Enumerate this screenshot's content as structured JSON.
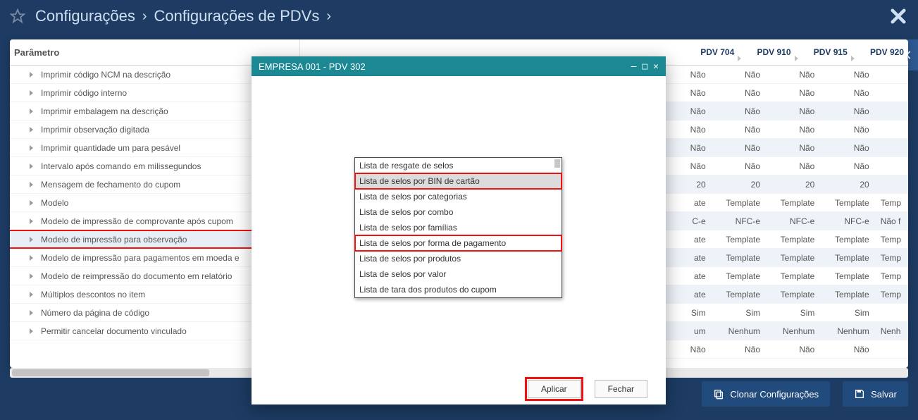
{
  "breadcrumb": {
    "a": "Configurações",
    "b": "Configurações de PDVs"
  },
  "param_header": "Parâmetro",
  "params": [
    {
      "label": "Imprimir código NCM na descrição"
    },
    {
      "label": "Imprimir código interno"
    },
    {
      "label": "Imprimir embalagem na descrição"
    },
    {
      "label": "Imprimir observação digitada"
    },
    {
      "label": "Imprimir quantidade um para pesável"
    },
    {
      "label": "Intervalo após comando em milissegundos"
    },
    {
      "label": "Mensagem de fechamento do cupom"
    },
    {
      "label": "Modelo"
    },
    {
      "label": "Modelo de impressão de comprovante após cupom"
    },
    {
      "label": "Modelo de impressão para observação",
      "highlight": true
    },
    {
      "label": "Modelo de impressão para pagamentos em moeda e"
    },
    {
      "label": "Modelo de reimpressão do documento em relatório"
    },
    {
      "label": "Múltiplos descontos no item"
    },
    {
      "label": "Número da página de código"
    },
    {
      "label": "Permitir cancelar documento vinculado"
    }
  ],
  "pdv_headers": [
    "PDV 704",
    "PDV 910",
    "PDV 915",
    "PDV 920"
  ],
  "data_rows": [
    {
      "vals": [
        "Não",
        "Não",
        "Não",
        "Não"
      ],
      "alt": false,
      "cut": true
    },
    {
      "vals": [
        "Não",
        "Não",
        "Não",
        "Não"
      ],
      "alt": false
    },
    {
      "vals": [
        "Não",
        "Não",
        "Não",
        "Não"
      ],
      "alt": true
    },
    {
      "vals": [
        "Não",
        "Não",
        "Não",
        "Não"
      ],
      "alt": false
    },
    {
      "vals": [
        "Não",
        "Não",
        "Não",
        "Não"
      ],
      "alt": true
    },
    {
      "vals": [
        "Não",
        "Não",
        "Não",
        "Não"
      ],
      "alt": false
    },
    {
      "vals": [
        "20",
        "20",
        "20",
        "20"
      ],
      "alt": true
    },
    {
      "vals": [
        "ate",
        "Template",
        "Template",
        "Template",
        "Temp"
      ],
      "alt": false
    },
    {
      "vals": [
        "C-e",
        "NFC-e",
        "NFC-e",
        "NFC-e",
        "Não f"
      ],
      "alt": true
    },
    {
      "vals": [
        "ate",
        "Template",
        "Template",
        "Template",
        "Temp"
      ],
      "alt": false
    },
    {
      "vals": [
        "ate",
        "Template",
        "Template",
        "Template",
        "Temp"
      ],
      "alt": true,
      "hl": true
    },
    {
      "vals": [
        "ate",
        "Template",
        "Template",
        "Template",
        "Temp"
      ],
      "alt": false
    },
    {
      "vals": [
        "ate",
        "Template",
        "Template",
        "Template",
        "Temp"
      ],
      "alt": true
    },
    {
      "vals": [
        "Sim",
        "Sim",
        "Sim",
        "Sim"
      ],
      "alt": false
    },
    {
      "vals": [
        "um",
        "Nenhum",
        "Nenhum",
        "Nenhum",
        "Nenh"
      ],
      "alt": true
    },
    {
      "vals": [
        "Não",
        "Não",
        "Não",
        "Não"
      ],
      "alt": false
    }
  ],
  "buttons": {
    "clone": "Clonar Configurações",
    "save": "Salvar"
  },
  "modal": {
    "title": "EMPRESA 001 - PDV 302",
    "options": [
      {
        "label": "Lista de resgate de selos"
      },
      {
        "label": "Lista de selos por BIN de cartão",
        "selected": true,
        "red": true
      },
      {
        "label": "Lista de selos por categorias"
      },
      {
        "label": "Lista de selos por combo"
      },
      {
        "label": "Lista de selos por famílias"
      },
      {
        "label": "Lista de selos por forma de pagamento",
        "red": true
      },
      {
        "label": "Lista de selos por produtos"
      },
      {
        "label": "Lista de selos por valor"
      },
      {
        "label": "Lista de tara dos produtos do cupom"
      }
    ],
    "apply": "Aplicar",
    "close": "Fechar"
  }
}
